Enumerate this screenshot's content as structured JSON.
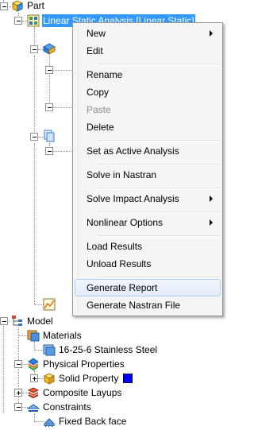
{
  "tree": {
    "part_label": "Part",
    "analysis_label": "Linear Static Analysis  [Linear Static]",
    "model_label": "Model",
    "materials_label": "Materials",
    "material_item": "16-25-6 Stainless Steel",
    "physical_properties_label": "Physical Properties",
    "solid_property_label": "Solid Property",
    "solid_property_color": "#0000ff",
    "composite_layups_label": "Composite Layups",
    "constraints_label": "Constraints",
    "constraint_item": "Fixed Back face"
  },
  "context_menu": {
    "items": [
      {
        "label": "New",
        "submenu": true,
        "disabled": false
      },
      {
        "label": "Edit",
        "submenu": false,
        "disabled": false
      },
      {
        "label": "Rename",
        "submenu": false,
        "disabled": false
      },
      {
        "label": "Copy",
        "submenu": false,
        "disabled": false
      },
      {
        "label": "Paste",
        "submenu": false,
        "disabled": true
      },
      {
        "label": "Delete",
        "submenu": false,
        "disabled": false
      },
      {
        "label": "Set as Active Analysis",
        "submenu": false,
        "disabled": false
      },
      {
        "label": "Solve in Nastran",
        "submenu": false,
        "disabled": false
      },
      {
        "label": "Solve Impact Analysis",
        "submenu": true,
        "disabled": false
      },
      {
        "label": "Nonlinear Options",
        "submenu": true,
        "disabled": false
      },
      {
        "label": "Load Results",
        "submenu": false,
        "disabled": false
      },
      {
        "label": "Unload Results",
        "submenu": false,
        "disabled": false
      },
      {
        "label": "Generate Report",
        "submenu": false,
        "disabled": false,
        "hovered": true
      },
      {
        "label": "Generate Nastran File",
        "submenu": false,
        "disabled": false
      }
    ]
  },
  "colors": {
    "selection": "#3399ff",
    "menu_background": "#f5f5f5",
    "hover_border": "#aecff7"
  }
}
